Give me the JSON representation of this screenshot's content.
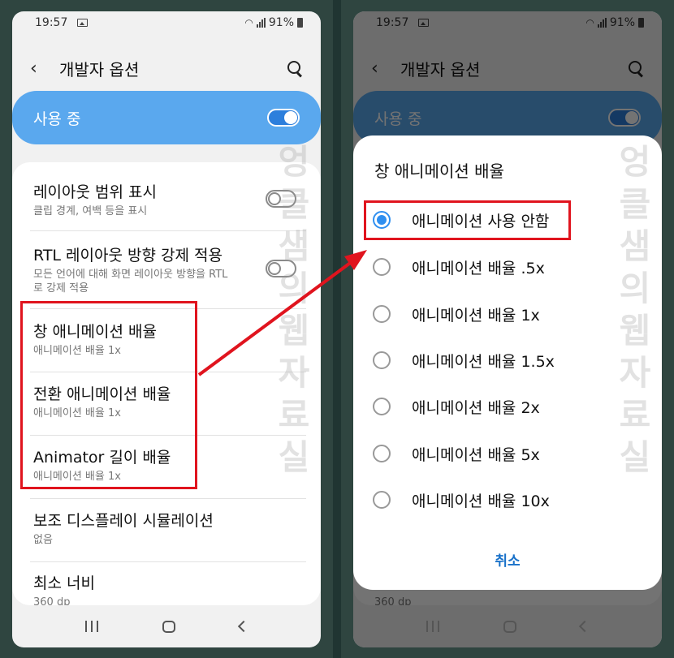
{
  "status_bar": {
    "time": "19:57",
    "battery": "91%"
  },
  "app_bar": {
    "title": "개발자 옵션"
  },
  "master_switch": {
    "label": "사용 중",
    "on": true
  },
  "settings": [
    {
      "title": "레이아웃 범위 표시",
      "subtitle": "클립 경계, 여백 등을 표시",
      "toggle": "off"
    },
    {
      "title": "RTL 레이아웃 방향 강제 적용",
      "subtitle": "모든 언어에 대해 화면 레이아웃 방향을 RTL로 강제 적용",
      "toggle": "off"
    },
    {
      "title": "창 애니메이션 배율",
      "subtitle": "애니메이션 배율 1x"
    },
    {
      "title": "전환 애니메이션 배율",
      "subtitle": "애니메이션 배율 1x"
    },
    {
      "title": "Animator 길이 배율",
      "subtitle": "애니메이션 배율 1x"
    },
    {
      "title": "보조 디스플레이 시뮬레이션",
      "subtitle": "없음"
    },
    {
      "title": "최소 너비",
      "subtitle": "360 dp"
    }
  ],
  "dialog": {
    "title": "창 애니메이션 배율",
    "options": [
      "애니메이션 사용 안함",
      "애니메이션 배율 .5x",
      "애니메이션 배율 1x",
      "애니메이션 배율 1.5x",
      "애니메이션 배율 2x",
      "애니메이션 배율 5x",
      "애니메이션 배율 10x"
    ],
    "selected_index": 0,
    "cancel_label": "취소"
  },
  "watermark": "엉클샘의웹자료실",
  "colors": {
    "accent": "#2f8ff0",
    "highlight_box": "#e0141e",
    "master_card": "#5aa8ee"
  }
}
